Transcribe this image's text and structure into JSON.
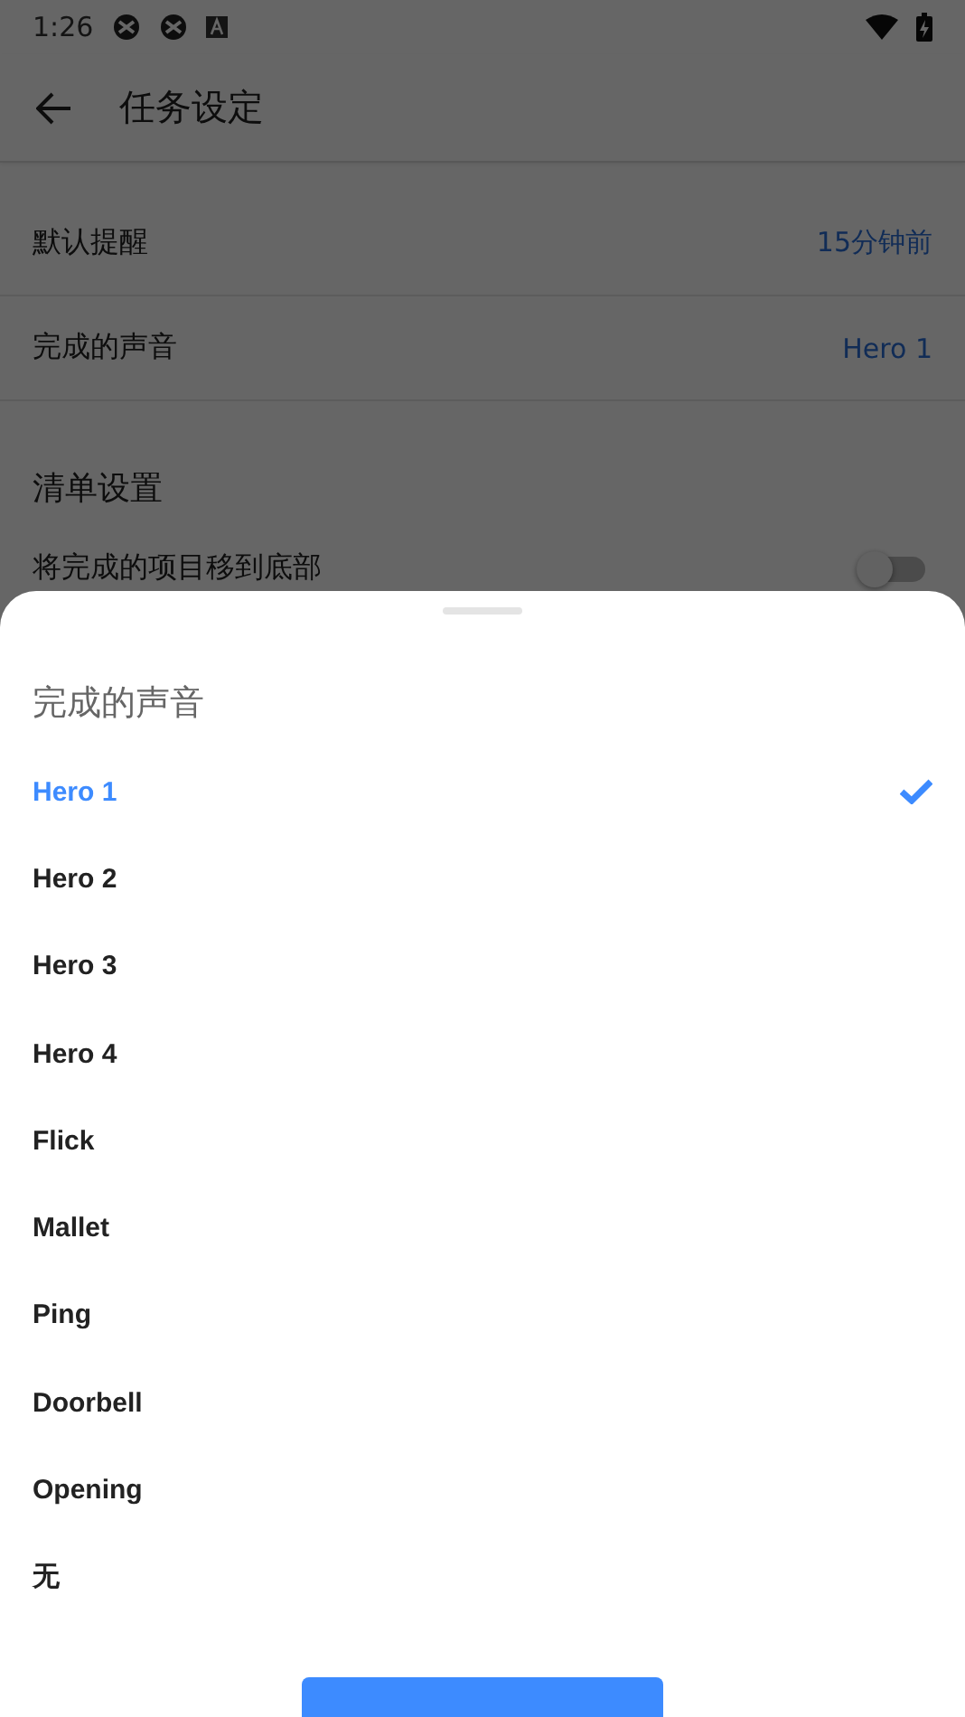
{
  "status_bar": {
    "time": "1:26"
  },
  "header": {
    "title": "任务设定"
  },
  "settings": [
    {
      "label": "默认提醒",
      "value": "15分钟前"
    },
    {
      "label": "完成的声音",
      "value": "Hero 1"
    }
  ],
  "section": {
    "title": "清单设置",
    "toggle_row": {
      "label": "将完成的项目移到底部",
      "on": false
    }
  },
  "sheet": {
    "title": "完成的声音",
    "options": [
      {
        "label": "Hero 1",
        "selected": true
      },
      {
        "label": "Hero 2",
        "selected": false
      },
      {
        "label": "Hero 3",
        "selected": false
      },
      {
        "label": "Hero 4",
        "selected": false
      },
      {
        "label": "Flick",
        "selected": false
      },
      {
        "label": "Mallet",
        "selected": false
      },
      {
        "label": "Ping",
        "selected": false
      },
      {
        "label": "Doorbell",
        "selected": false
      },
      {
        "label": "Opening",
        "selected": false
      },
      {
        "label": "无",
        "selected": false
      }
    ]
  }
}
